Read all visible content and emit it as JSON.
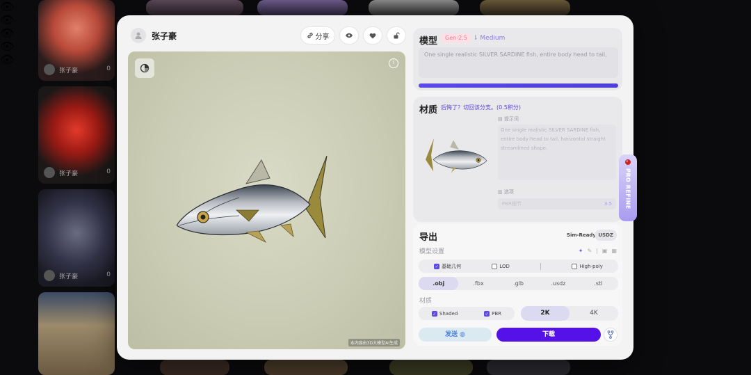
{
  "header": {
    "username": "张子豪",
    "share_label": "分享"
  },
  "viewer": {
    "info_glyph": "i",
    "footer_text": "本内容由3D大模型AI生成"
  },
  "model_panel": {
    "title": "模型",
    "gen_tag": "Gen-2.5",
    "quality_tag": "Medium",
    "prompt": "One single realistic SILVER SARDINE fish, entire body head to tail,"
  },
  "material_panel": {
    "title": "材质",
    "note": "后悔了？切回该分支。(0.5积分)",
    "prompt_label": "提示词",
    "prompt_text": "One single realistic SILVER SARDINE fish, entire body head to tail, horizontal straight streamlined shape.",
    "options_label": "选项",
    "pbr_label": "PBR细节",
    "pbr_value": "3.5"
  },
  "export_panel": {
    "title": "导出",
    "sim_ready": "Sim-Ready",
    "usdz_tag": "USDZ",
    "model_settings_label": "模型设置",
    "geometry_options": [
      {
        "label": "基础几何",
        "checked": true
      },
      {
        "label": "LOD",
        "checked": false
      },
      {
        "label": "High-poly",
        "checked": false
      }
    ],
    "formats": [
      ".obj",
      ".fbx",
      ".glb",
      ".usdz",
      ".stl"
    ],
    "active_format": ".obj",
    "material_label": "材质",
    "material_options": [
      {
        "label": "Shaded",
        "checked": true
      },
      {
        "label": "PBR",
        "checked": true
      }
    ],
    "resolutions": [
      "2K",
      "4K"
    ],
    "active_resolution": "2K",
    "send_label": "发送",
    "download_label": "下载"
  },
  "pro_refine_label": "PRO REFINE",
  "background_cards": [
    {
      "user": "张子豪",
      "count": "0"
    },
    {
      "user": "张子豪",
      "count": "0"
    },
    {
      "user": "张子豪",
      "count": "0"
    }
  ],
  "colors": {
    "accent": "#5412e8",
    "progress": "#5b4ae6",
    "viewer_bg": "#c9cbb3"
  }
}
